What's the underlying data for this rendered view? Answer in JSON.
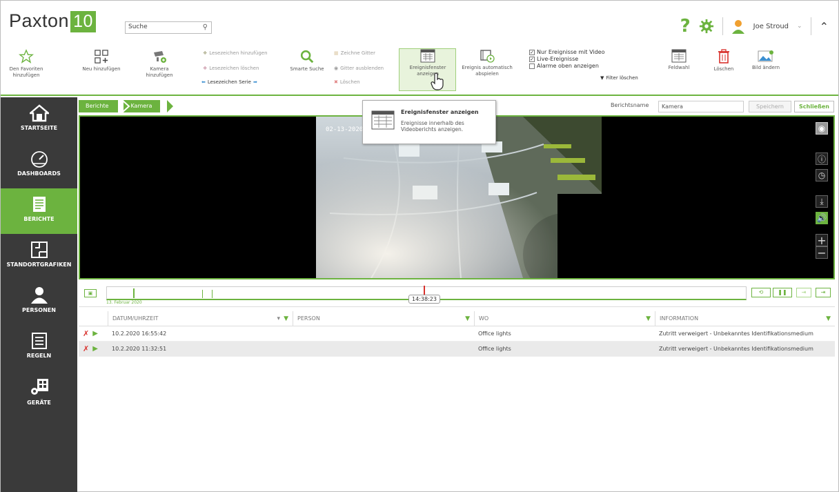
{
  "app": {
    "logo_text": "Paxton",
    "logo_number": "10"
  },
  "header": {
    "search_value": "Suche",
    "user_name": "Joe Stroud",
    "help": "?"
  },
  "ribbon": {
    "favorites": "Den Favoriten hinzufügen",
    "add_new": "Neu hinzufügen",
    "add_camera": "Kamera hinzufügen",
    "add_bookmark": "Lesezeichen hinzufügen",
    "delete_bookmark": "Lesezeichen löschen",
    "bookmark_series": "Lesezeichen Serie",
    "smart_search": "Smarte Suche",
    "draw_grid": "Zeichne Gitter",
    "hide_grid": "Gitter ausblenden",
    "delete_small": "Löschen",
    "show_event_window": "Ereignisfenster anzeigen",
    "autoplay_event": "Ereignis automatisch abspielen",
    "only_video_events": "Nur Ereignisse mit Video",
    "live_events": "Live-Ereignisse",
    "alarms_on_top": "Alarme oben anzeigen",
    "clear_filter": "Filter löschen",
    "field_select": "Feldwahl",
    "delete": "Löschen",
    "change_image": "Bild ändern"
  },
  "sidebar": {
    "items": [
      {
        "label": "STARTSEITE"
      },
      {
        "label": "DASHBOARDS"
      },
      {
        "label": "BERICHTE"
      },
      {
        "label": "STANDORTGRAFIKEN"
      },
      {
        "label": "PERSONEN"
      },
      {
        "label": "REGELN"
      },
      {
        "label": "GERÄTE"
      }
    ]
  },
  "breadcrumb": {
    "first": "Berichte",
    "second": "Kamera"
  },
  "report": {
    "name_label": "Berichtsname",
    "name_value": "Kamera",
    "save": "Speichern",
    "close": "Schließen"
  },
  "tooltip": {
    "title": "Ereignisfenster anzeigen",
    "description": "Ereignisse innerhalb des Videoberichts anzeigen."
  },
  "video": {
    "timestamp": "02-13-2020"
  },
  "timeline": {
    "date": "13. Februar 2020",
    "time": "14:38:23"
  },
  "table": {
    "headers": [
      "DATUM/UHRZEIT",
      "PERSON",
      "WO",
      "INFORMATION"
    ],
    "rows": [
      {
        "datetime": "10.2.2020 16:55:42",
        "person": "",
        "where": "Office lights",
        "info": "Zutritt verweigert - Unbekanntes Identifikationsmedium"
      },
      {
        "datetime": "10.2.2020 11:32:51",
        "person": "",
        "where": "Office lights",
        "info": "Zutritt verweigert - Unbekanntes Identifikationsmedium"
      }
    ]
  },
  "colors": {
    "accent": "#6cb33f",
    "sidebar": "#3a3a3a",
    "delete": "#d9302b"
  }
}
